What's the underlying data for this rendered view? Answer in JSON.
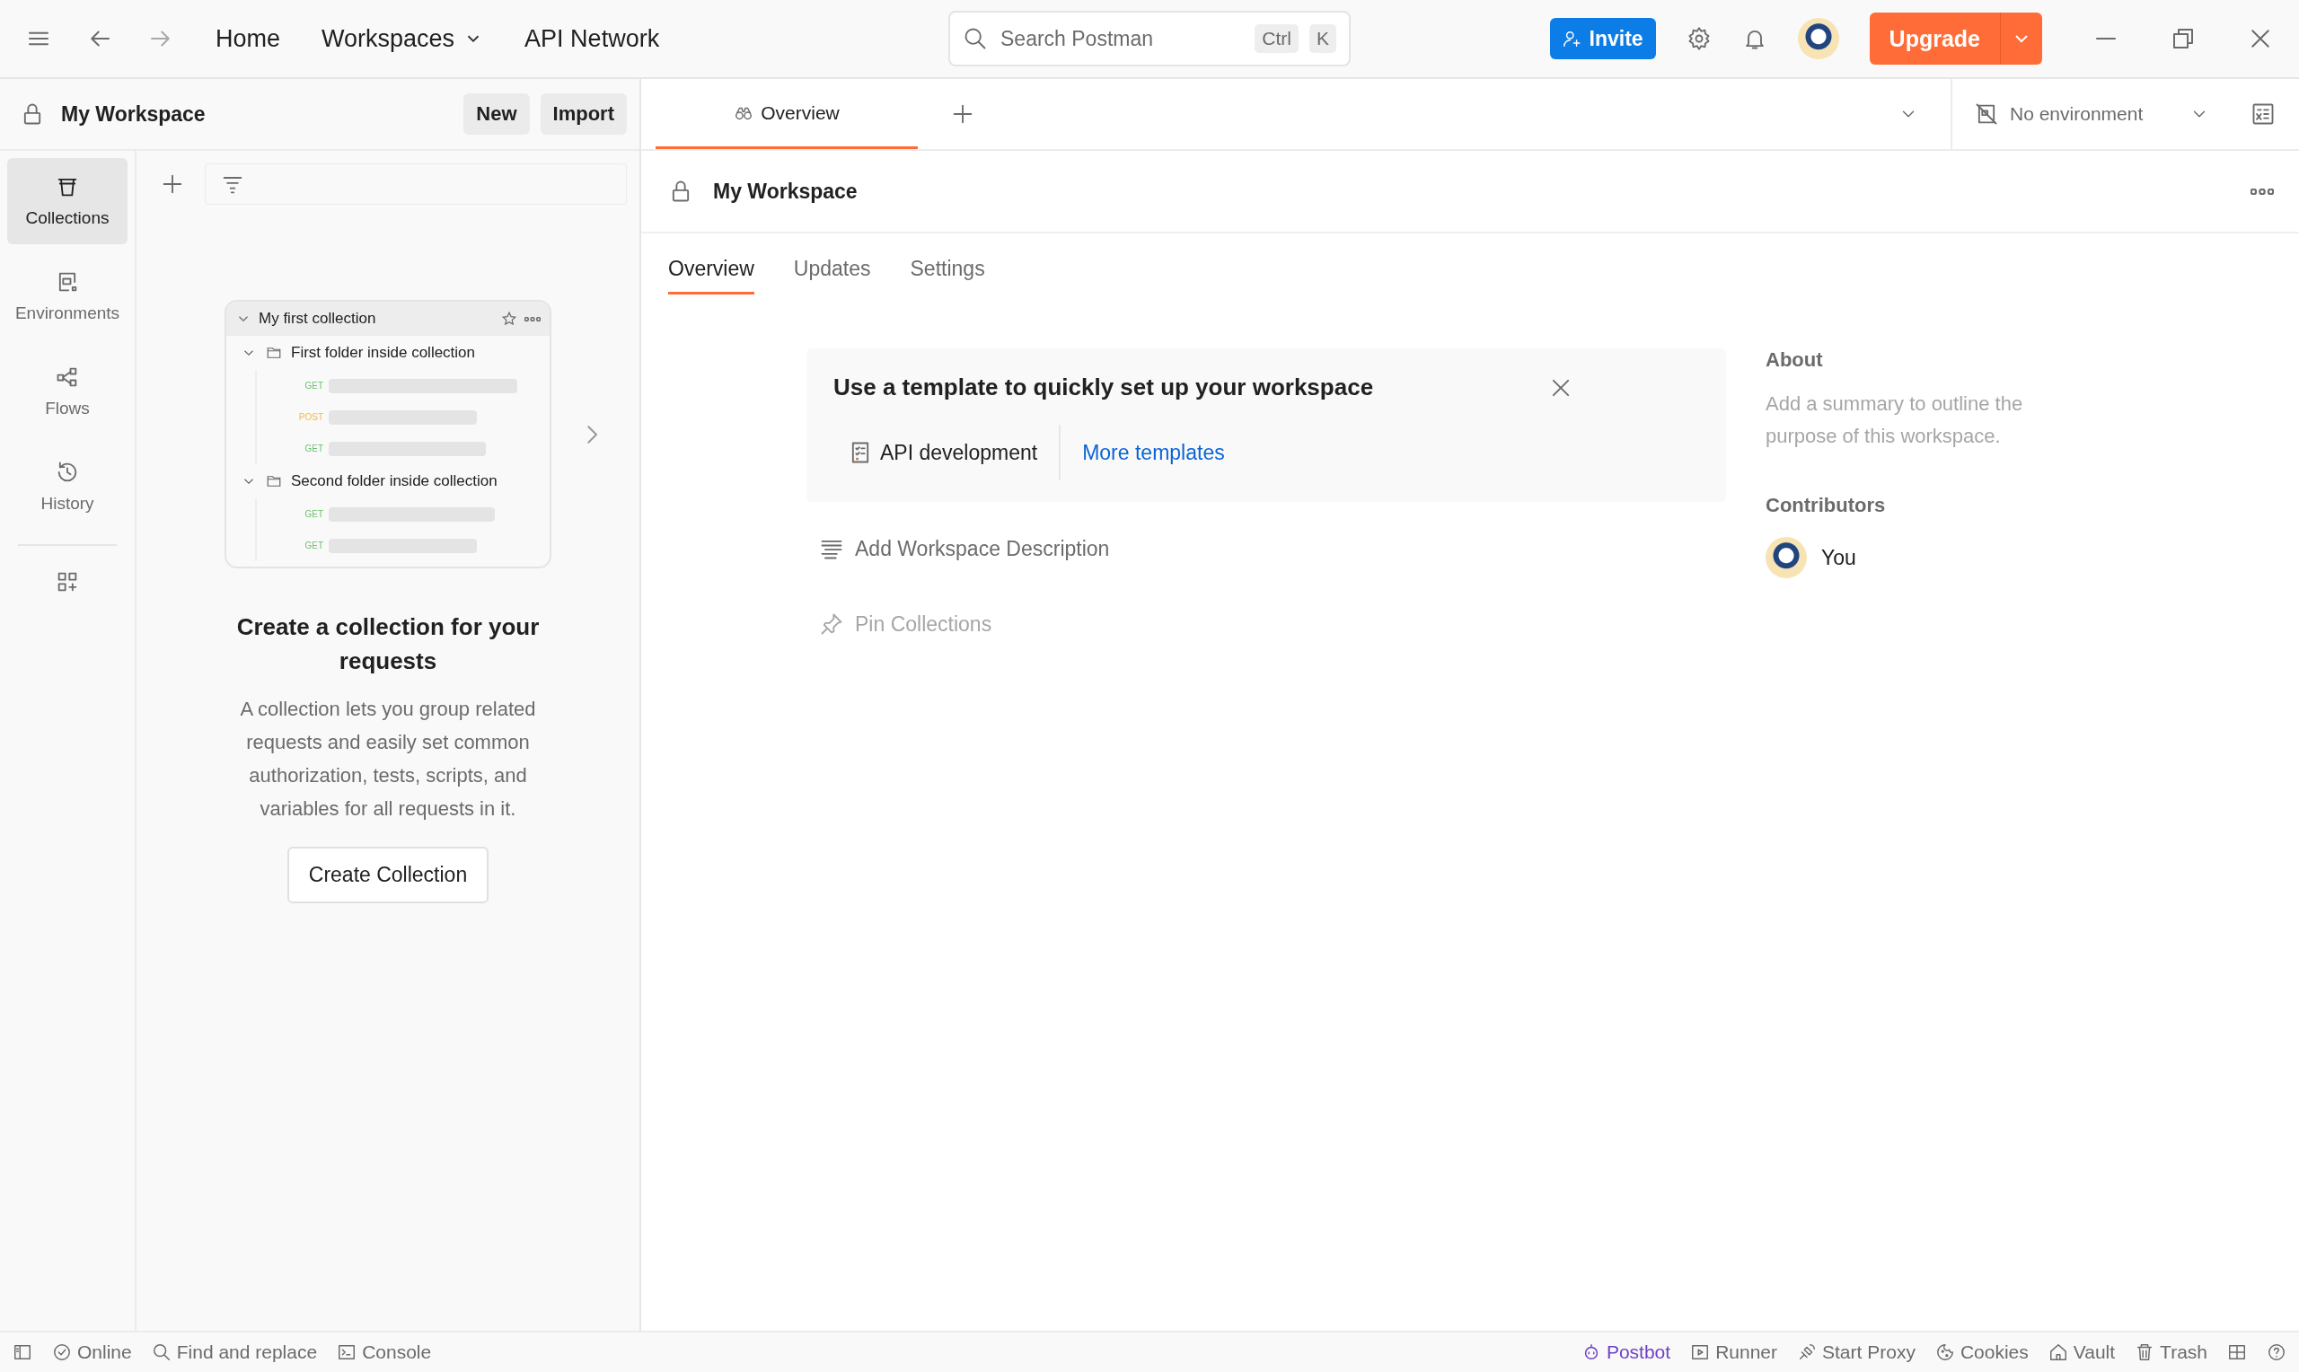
{
  "topbar": {
    "nav": [
      {
        "label": "Home",
        "dropdown": false
      },
      {
        "label": "Workspaces",
        "dropdown": true
      },
      {
        "label": "API Network",
        "dropdown": false
      }
    ],
    "search": {
      "placeholder": "Search Postman",
      "keys": [
        "Ctrl",
        "K"
      ]
    },
    "invite": "Invite",
    "upgrade": "Upgrade"
  },
  "sidebar": {
    "workspace": "My Workspace",
    "buttons": [
      "New",
      "Import"
    ],
    "rail": [
      {
        "label": "Collections",
        "kind": "collections",
        "selected": true
      },
      {
        "label": "Environments",
        "kind": "environments",
        "selected": false
      },
      {
        "label": "Flows",
        "kind": "flows",
        "selected": false
      },
      {
        "label": "History",
        "kind": "history",
        "selected": false
      }
    ],
    "preview": {
      "collection": "My first collection",
      "folders": [
        {
          "name": "First folder inside collection",
          "requests": [
            {
              "method": "GET",
              "color": "#6cc070"
            },
            {
              "method": "POST",
              "color": "#f2b84b"
            },
            {
              "method": "GET",
              "color": "#6cc070"
            }
          ]
        },
        {
          "name": "Second folder inside collection",
          "requests": [
            {
              "method": "GET",
              "color": "#6cc070"
            },
            {
              "method": "GET",
              "color": "#6cc070"
            }
          ]
        }
      ]
    },
    "empty": {
      "title": "Create a collection for your requests",
      "text": "A collection lets you group related requests and easily set common authorization, tests, scripts, and variables for all requests in it.",
      "button": "Create Collection"
    }
  },
  "tabs": [
    {
      "label": "Overview",
      "selected": true
    }
  ],
  "environment": "No environment",
  "workspace": {
    "title": "My Workspace",
    "subtabs": [
      {
        "label": "Overview",
        "selected": true
      },
      {
        "label": "Updates",
        "selected": false
      },
      {
        "label": "Settings",
        "selected": false
      }
    ],
    "template_card": {
      "title": "Use a template to quickly set up your workspace",
      "template": "API development",
      "link": "More templates"
    },
    "actions": [
      {
        "label": "Add Workspace Description",
        "kind": "description",
        "disabled": false
      },
      {
        "label": "Pin Collections",
        "kind": "pin",
        "disabled": true
      }
    ],
    "about": {
      "heading": "About",
      "hint": "Add a summary to outline the purpose of this workspace."
    },
    "contributors": {
      "heading": "Contributors",
      "people": [
        "You"
      ]
    }
  },
  "status_bar": {
    "left": [
      {
        "label": "Online",
        "kind": "online"
      },
      {
        "label": "Find and replace",
        "kind": "find"
      },
      {
        "label": "Console",
        "kind": "console"
      }
    ],
    "right": [
      {
        "label": "Postbot",
        "kind": "postbot"
      },
      {
        "label": "Runner",
        "kind": "runner"
      },
      {
        "label": "Start Proxy",
        "kind": "proxy"
      },
      {
        "label": "Cookies",
        "kind": "cookies"
      },
      {
        "label": "Vault",
        "kind": "vault"
      },
      {
        "label": "Trash",
        "kind": "trash"
      }
    ]
  }
}
